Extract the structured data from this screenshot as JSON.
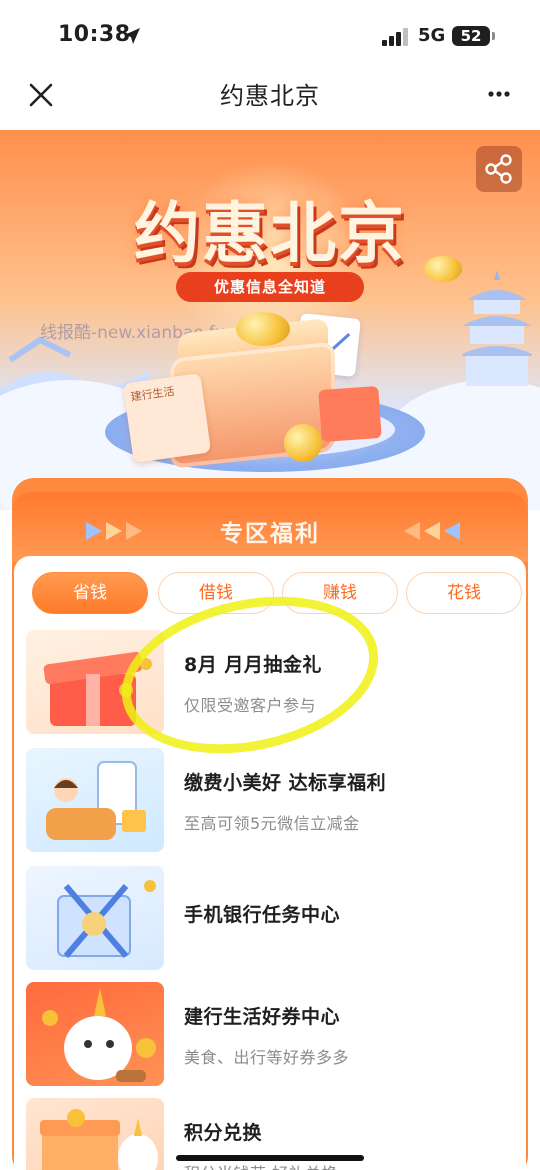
{
  "status_bar": {
    "time": "10:38",
    "network": "5G",
    "battery": "52"
  },
  "nav": {
    "title": "约惠北京",
    "close_icon": "close-icon",
    "more_icon": "more-icon"
  },
  "banner": {
    "title": "约惠北京",
    "subtitle": "优惠信息全知道",
    "wallet_label": "建行生活",
    "watermark": "线报酷-new.xianbao.fun",
    "share_icon": "share-icon"
  },
  "zone": {
    "title": "专区福利",
    "tabs": [
      {
        "label": "省钱",
        "active": true
      },
      {
        "label": "借钱",
        "active": false
      },
      {
        "label": "赚钱",
        "active": false
      },
      {
        "label": "花钱",
        "active": false
      }
    ],
    "items": [
      {
        "title": "8月 月月抽金礼",
        "subtitle": "仅限受邀客户参与"
      },
      {
        "title": "缴费小美好 达标享福利",
        "subtitle": "至高可领5元微信立减金"
      },
      {
        "title": "手机银行任务中心",
        "subtitle": ""
      },
      {
        "title": "建行生活好券中心",
        "subtitle": "美食、出行等好券多多"
      },
      {
        "title": "积分兑换",
        "subtitle": "积分当钱花 好礼兑换"
      }
    ]
  },
  "colors": {
    "accent": "#ff7a2b",
    "zone_bg": "#ff8a3d",
    "highlight": "#f0f014"
  }
}
